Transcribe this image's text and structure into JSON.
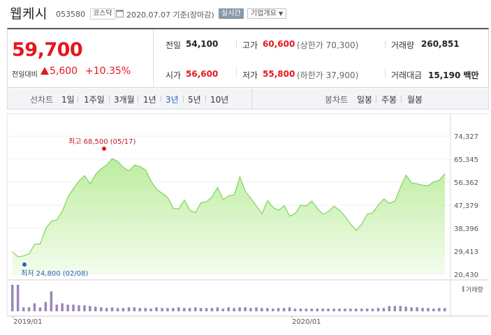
{
  "header": {
    "name": "웹케시",
    "code": "053580",
    "market": "코스닥",
    "date": "2020.07.07",
    "basis": "기준(장마감)",
    "realtime": "실시간",
    "company_info": "기업개요"
  },
  "price": {
    "current": "59,700",
    "change_label": "전일대비",
    "change": "5,600",
    "change_pct": "+10.35%"
  },
  "stats": {
    "prev_label": "전일",
    "prev": "54,100",
    "high_label": "고가",
    "high": "60,600",
    "upper_limit": "(상한가 70,300)",
    "volume_label": "거래량",
    "volume": "260,851",
    "open_label": "시가",
    "open": "56,600",
    "low_label": "저가",
    "low": "55,800",
    "lower_limit": "(하한가 37,900)",
    "amount_label": "거래대금",
    "amount": "15,190",
    "amount_unit": "백만"
  },
  "periods": {
    "line_label": "선차트",
    "items": [
      "1일",
      "1주일",
      "3개월",
      "1년",
      "3년",
      "5년",
      "10년"
    ],
    "active": "3년",
    "candle_label": "봉차트",
    "candle_items": [
      "일봉",
      "주봉",
      "월봉"
    ]
  },
  "colors": {
    "up": "#e6161d",
    "accent": "#2962b8",
    "line": "#7fd35a",
    "volume": "#9a86b8"
  },
  "chart_data": {
    "type": "area",
    "y_ticks": [
      "74,327",
      "65,345",
      "56,362",
      "47,379",
      "38,396",
      "29,413",
      "20,430"
    ],
    "ylim": [
      20430,
      74327
    ],
    "x_ticks": [
      "2019/01",
      "2020/01"
    ],
    "max_label": "최고 68,500 (05/17)",
    "min_label": "최저 24,800 (02/08)",
    "volume_label": "거래량",
    "series": [
      {
        "values": [
          29100,
          27200,
          27600,
          28500,
          32100,
          32300,
          38300,
          41200,
          41600,
          45100,
          50600,
          53900,
          56800,
          58900,
          55700,
          59400,
          61600,
          63100,
          65600,
          64400,
          62100,
          60700,
          63000,
          62400,
          61100,
          56700,
          53500,
          52000,
          50400,
          46100,
          46000,
          49400,
          45400,
          44500,
          48300,
          48700,
          50700,
          54300,
          49500,
          51100,
          51400,
          58400,
          52800,
          50000,
          47000,
          44000,
          49200,
          46500,
          45400,
          47200,
          43100,
          44100,
          47400,
          47100,
          49000,
          46100,
          43800,
          44900,
          47000,
          45400,
          43000,
          40000,
          37500,
          40000,
          43900,
          44400,
          47500,
          49800,
          48100,
          49000,
          54500,
          59100,
          56000,
          55700,
          55100,
          55000,
          56500,
          57100,
          59700
        ]
      },
      {
        "name": "거래량",
        "values": [
          40,
          40,
          6,
          6,
          12,
          6,
          14,
          30,
          10,
          12,
          10,
          10,
          9,
          9,
          8,
          7,
          6,
          5,
          6,
          5,
          5,
          6,
          6,
          5,
          5,
          4,
          6,
          5,
          5,
          5,
          6,
          5,
          5,
          6,
          5,
          5,
          5,
          6,
          4,
          6,
          5,
          6,
          6,
          5,
          6,
          5,
          5,
          4,
          5,
          5,
          6,
          4,
          4,
          4,
          4,
          4,
          4,
          4,
          4,
          4,
          4,
          4,
          4,
          4,
          4,
          4,
          5,
          5,
          8,
          8,
          8,
          7,
          6,
          6,
          5,
          5,
          4,
          5,
          5
        ]
      }
    ]
  }
}
